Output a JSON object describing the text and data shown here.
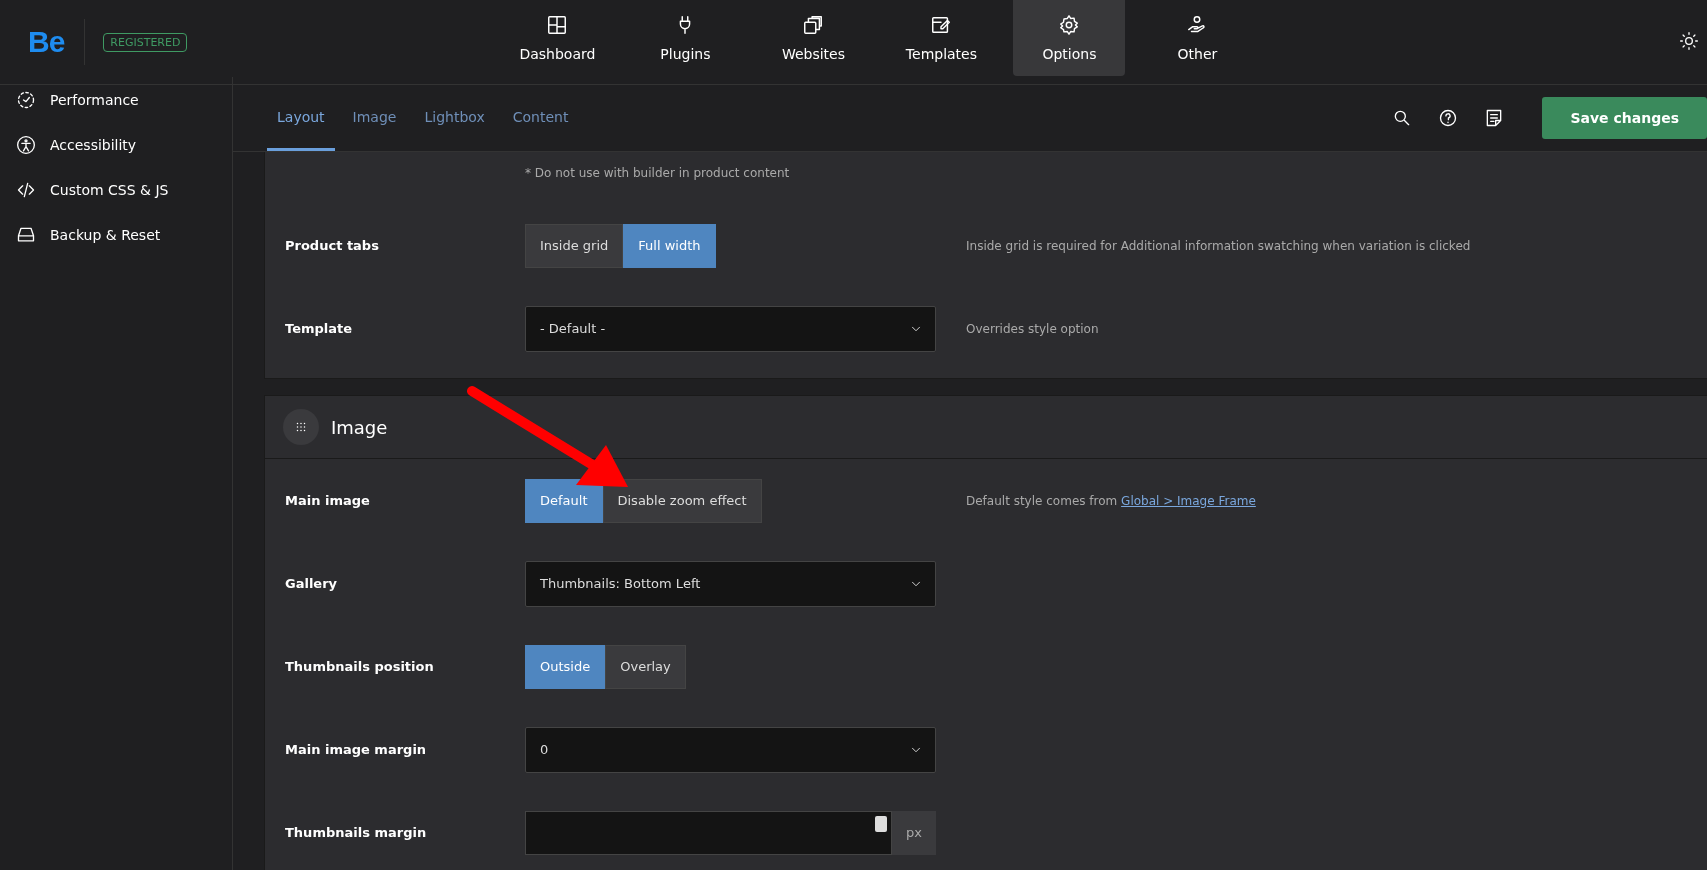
{
  "header": {
    "logo": "Be",
    "badge": "REGISTERED",
    "nav": [
      {
        "label": "Dashboard",
        "selected": false
      },
      {
        "label": "Plugins",
        "selected": false
      },
      {
        "label": "Websites",
        "selected": false
      },
      {
        "label": "Templates",
        "selected": false
      },
      {
        "label": "Options",
        "selected": true
      },
      {
        "label": "Other",
        "selected": false
      }
    ]
  },
  "sidebar": {
    "items": [
      {
        "label": "Performance"
      },
      {
        "label": "Accessibility"
      },
      {
        "label": "Custom CSS & JS"
      },
      {
        "label": "Backup & Reset"
      }
    ]
  },
  "tabs": [
    {
      "label": "Layout",
      "selected": true
    },
    {
      "label": "Image",
      "selected": false
    },
    {
      "label": "Lightbox",
      "selected": false
    },
    {
      "label": "Content",
      "selected": false
    }
  ],
  "save_button": "Save changes",
  "sections": [
    {
      "note": "* Do not use with builder in product content",
      "rows": [
        {
          "label": "Product tabs",
          "kind": "segmented",
          "options": [
            {
              "label": "Inside grid",
              "selected": false
            },
            {
              "label": "Full width",
              "selected": true
            }
          ],
          "hint": {
            "text": "Inside grid is required for Additional information swatching when variation is clicked"
          }
        },
        {
          "label": "Template",
          "kind": "select",
          "value": "- Default -",
          "hint": {
            "text": "Overrides style option"
          }
        }
      ]
    },
    {
      "title": "Image",
      "rows": [
        {
          "label": "Main image",
          "kind": "segmented",
          "options": [
            {
              "label": "Default",
              "selected": true
            },
            {
              "label": "Disable zoom effect",
              "selected": false
            }
          ],
          "hint": {
            "text": "Default style comes from ",
            "link": "Global > Image Frame"
          }
        },
        {
          "label": "Gallery",
          "kind": "select",
          "value": "Thumbnails: Bottom Left"
        },
        {
          "label": "Thumbnails position",
          "kind": "segmented",
          "options": [
            {
              "label": "Outside",
              "selected": true
            },
            {
              "label": "Overlay",
              "selected": false
            }
          ]
        },
        {
          "label": "Main image margin",
          "kind": "select",
          "value": "0"
        },
        {
          "label": "Thumbnails margin",
          "kind": "number",
          "unit": "px"
        }
      ]
    }
  ]
}
